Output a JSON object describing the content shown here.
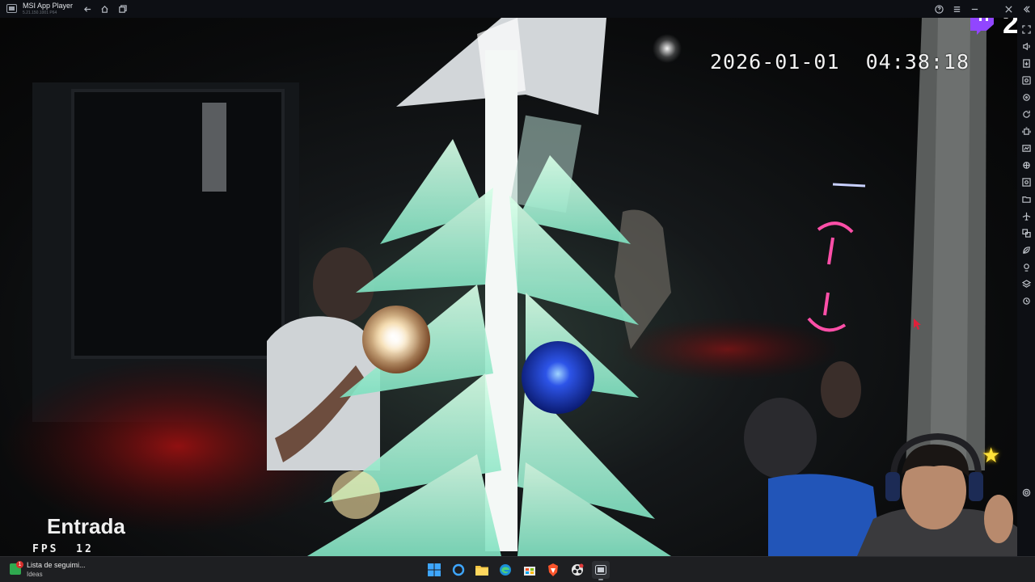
{
  "window": {
    "app_name": "MSI App Player",
    "app_version": "5.21.150.1001 P64"
  },
  "stream": {
    "timestamp": "2026-01-01  04:38:18",
    "camera_label": "Entrada",
    "fps_text": "FPS  12",
    "overlay_number": "2"
  },
  "taskbar": {
    "widget_title": "Lista de seguimi...",
    "widget_subtitle": "Ideas",
    "widget_badge": "1"
  },
  "colors": {
    "twitch": "#9146ff",
    "accent_blue": "#0078d4",
    "neon_pink": "#ff3fa0"
  },
  "icons": {
    "titlebar": [
      "back-icon",
      "home-icon",
      "multi-instance-icon",
      "help-icon",
      "menu-icon",
      "minimize-icon",
      "close-icon",
      "collapse-icon"
    ],
    "sidebar": [
      "fullscreen-icon",
      "volume-icon",
      "apk-icon",
      "screenshot-icon",
      "location-icon",
      "rotate-icon",
      "shake-icon",
      "performance-icon",
      "keymapping-icon",
      "screen-record-icon",
      "folder-icon",
      "airplane-icon",
      "multi-window-icon",
      "eco-icon",
      "macro-icon",
      "layers-icon",
      "sync-icon",
      "settings-icon"
    ]
  }
}
